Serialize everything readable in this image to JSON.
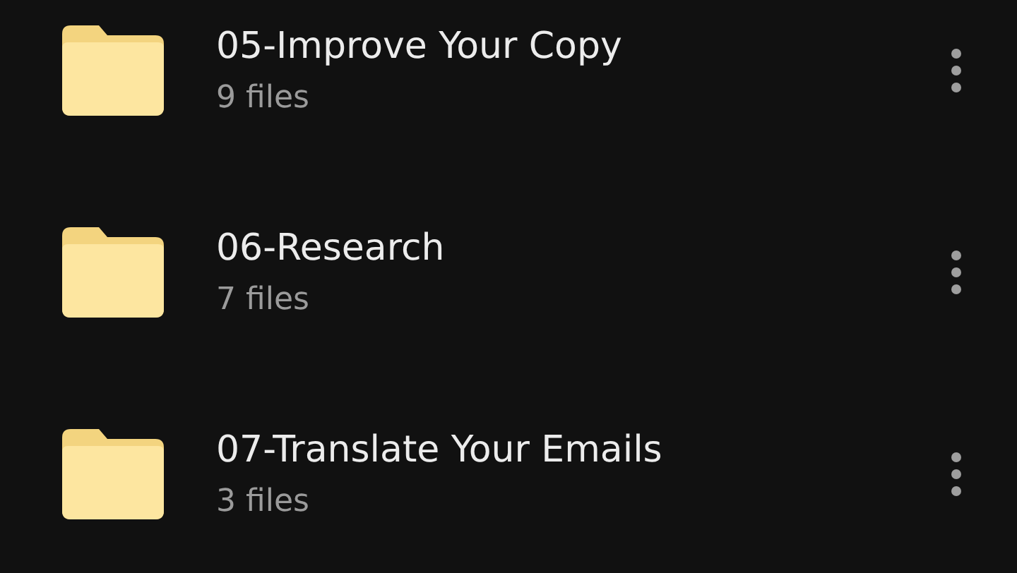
{
  "folders": [
    {
      "name": "05-Improve Your Copy",
      "count": "9 files"
    },
    {
      "name": "06-Research",
      "count": "7 files"
    },
    {
      "name": "07-Translate Your Emails",
      "count": "3 files"
    }
  ]
}
